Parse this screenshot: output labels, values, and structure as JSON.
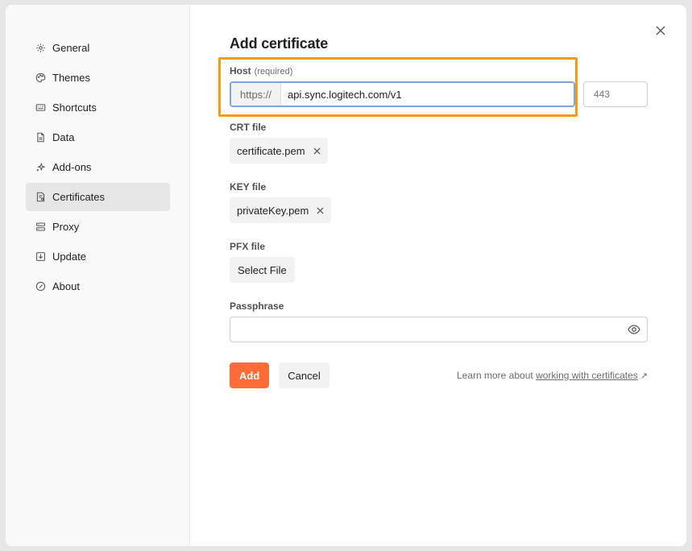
{
  "sidebar": {
    "items": [
      {
        "label": "General",
        "icon": "gear-icon"
      },
      {
        "label": "Themes",
        "icon": "palette-icon"
      },
      {
        "label": "Shortcuts",
        "icon": "keyboard-icon"
      },
      {
        "label": "Data",
        "icon": "file-icon"
      },
      {
        "label": "Add-ons",
        "icon": "sparkle-icon"
      },
      {
        "label": "Certificates",
        "icon": "certificate-icon",
        "active": true
      },
      {
        "label": "Proxy",
        "icon": "proxy-icon"
      },
      {
        "label": "Update",
        "icon": "download-icon"
      },
      {
        "label": "About",
        "icon": "info-icon"
      }
    ]
  },
  "dialog": {
    "title": "Add certificate",
    "host": {
      "label": "Host",
      "hint": "(required)",
      "prefix": "https://",
      "value": "api.sync.logitech.com/v1",
      "port_placeholder": "443"
    },
    "crt": {
      "label": "CRT file",
      "file": "certificate.pem"
    },
    "key": {
      "label": "KEY file",
      "file": "privateKey.pem"
    },
    "pfx": {
      "label": "PFX file",
      "button": "Select File"
    },
    "passphrase": {
      "label": "Passphrase",
      "value": ""
    },
    "actions": {
      "add": "Add",
      "cancel": "Cancel",
      "learn_prefix": "Learn more about",
      "learn_link": "working with certificates",
      "learn_arrow": "↗"
    },
    "close": "×"
  },
  "colors": {
    "accent": "#ff6c37",
    "highlight": "#f39c12",
    "focus": "#7aa7d8"
  }
}
